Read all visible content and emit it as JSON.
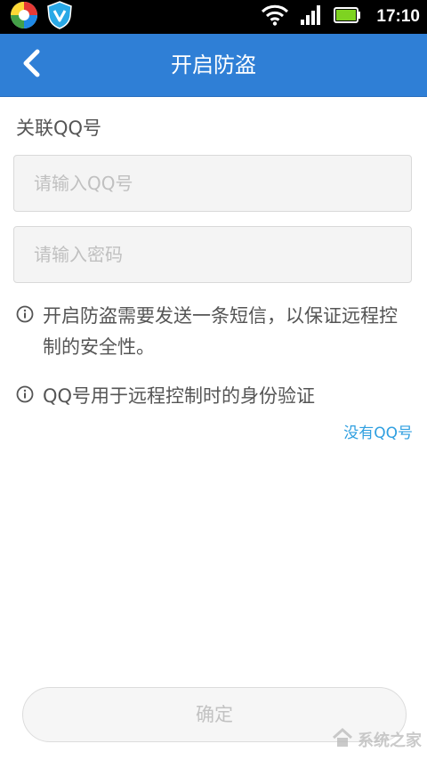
{
  "status_bar": {
    "time": "17:10",
    "app_icons": [
      "colorful-circle-app-icon",
      "shield-v-app-icon"
    ],
    "indicators": [
      "wifi-icon",
      "signal-bars-icon",
      "battery-icon"
    ],
    "battery_color": "#7ed321"
  },
  "header": {
    "title": "开启防盗",
    "back_icon": "chevron-left-icon",
    "background": "#2f7fd6"
  },
  "form": {
    "section_label": "关联QQ号",
    "qq_placeholder": "请输入QQ号",
    "qq_value": "",
    "password_placeholder": "请输入密码",
    "password_value": ""
  },
  "notes": [
    {
      "icon": "info-icon",
      "text": "开启防盗需要发送一条短信，以保证远程控制的安全性。"
    },
    {
      "icon": "info-icon",
      "text": "QQ号用于远程控制时的身份验证"
    }
  ],
  "links": {
    "no_qq": "没有QQ号"
  },
  "buttons": {
    "confirm": "确定"
  },
  "watermark": {
    "text": "系统之家"
  },
  "colors": {
    "accent": "#2f7fd6",
    "link": "#2f9fe0"
  }
}
